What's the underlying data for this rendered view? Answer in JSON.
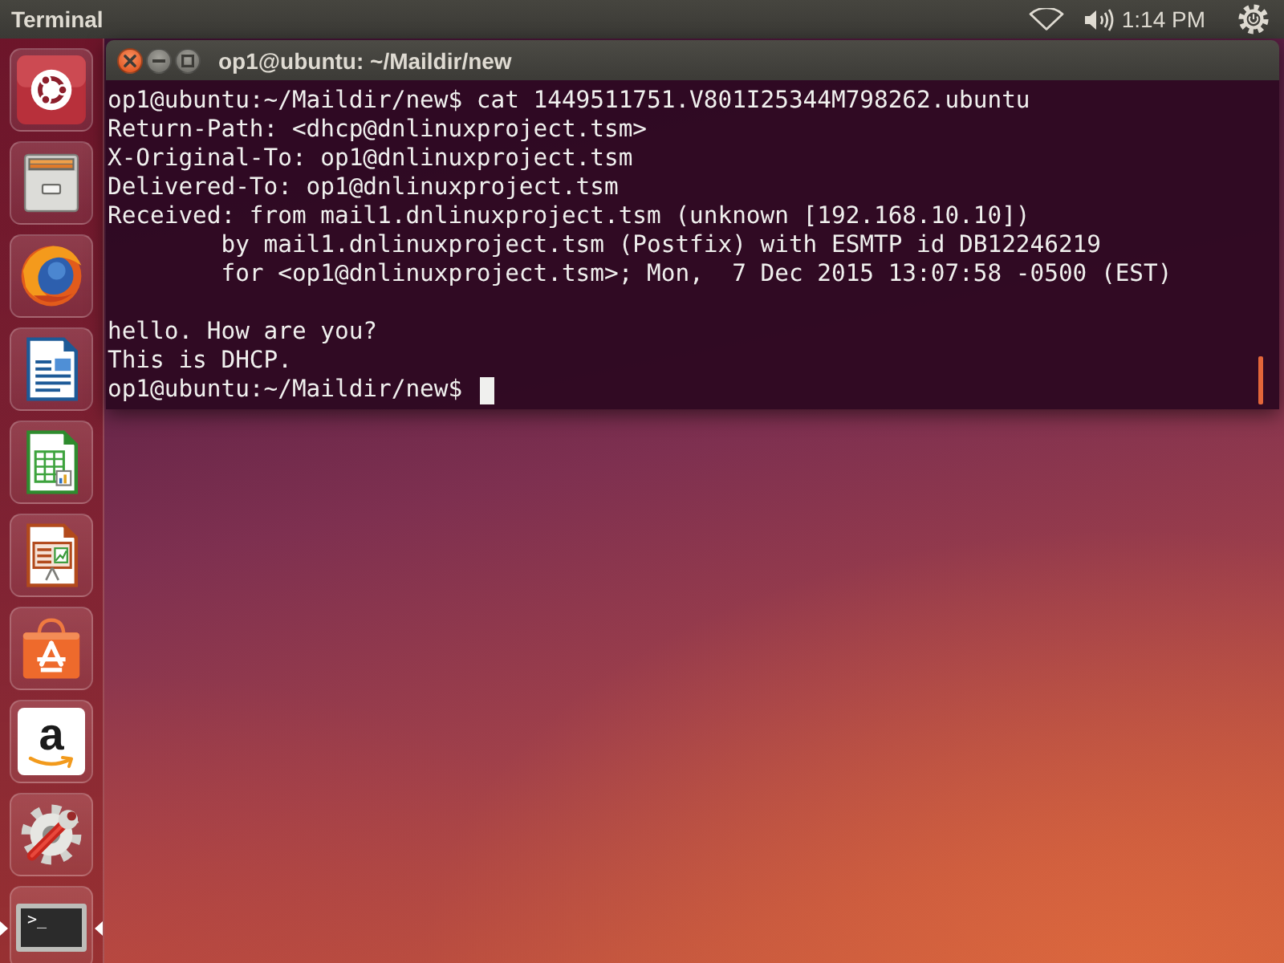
{
  "top_panel": {
    "app_name": "Terminal",
    "clock": "1:14 PM"
  },
  "launcher": {
    "items": [
      {
        "kind": "dash",
        "active": false
      },
      {
        "kind": "files",
        "active": false
      },
      {
        "kind": "browser",
        "active": false
      },
      {
        "kind": "writer",
        "active": false
      },
      {
        "kind": "calc",
        "active": false
      },
      {
        "kind": "impress",
        "active": false
      },
      {
        "kind": "store",
        "active": false
      },
      {
        "kind": "amazon",
        "active": false,
        "glyph": "a"
      },
      {
        "kind": "settings",
        "active": false
      },
      {
        "kind": "terminal",
        "active": true,
        "glyph": ">_"
      }
    ]
  },
  "terminal_window": {
    "title": "op1@ubuntu: ~/Maildir/new",
    "blocks": [
      {
        "lines": [
          "op1@ubuntu:~/Maildir/new$ cat 1449511751.V801I25344M798262.ubuntu",
          "Return-Path: <dhcp@dnlinuxproject.tsm>",
          "X-Original-To: op1@dnlinuxproject.tsm",
          "Delivered-To: op1@dnlinuxproject.tsm",
          "Received: from mail1.dnlinuxproject.tsm (unknown [192.168.10.10])",
          "        by mail1.dnlinuxproject.tsm (Postfix) with ESMTP id DB12246219",
          "        for <op1@dnlinuxproject.tsm>; Mon,  7 Dec 2015 13:07:58 -0500 (EST)"
        ]
      },
      {
        "lines": [
          "hello. How are you?",
          "This is DHCP."
        ]
      }
    ],
    "prompt": "op1@ubuntu:~/Maildir/new$",
    "cursor": true
  }
}
